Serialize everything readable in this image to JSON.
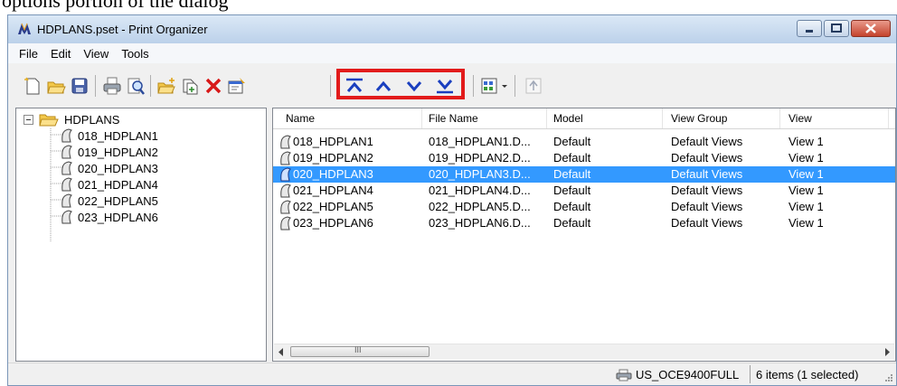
{
  "caption": "options portion of the dialog",
  "window": {
    "title": "HDPLANS.pset - Print Organizer",
    "app_icon": "microstation-icon"
  },
  "menu": [
    {
      "label": "File"
    },
    {
      "label": "Edit"
    },
    {
      "label": "View"
    },
    {
      "label": "Tools"
    }
  ],
  "toolbar_icons": [
    "new-icon",
    "open-folder-icon",
    "save-icon",
    "print-icon",
    "print-preview-icon",
    "add-folder-icon",
    "add-file-icon",
    "delete-icon",
    "properties-icon",
    "move-top-icon",
    "move-up-icon",
    "move-down-icon",
    "move-bottom-icon",
    "view-mode-icon",
    "up-level-icon"
  ],
  "colors": {
    "highlight": "#e21b1b",
    "selection": "#3399ff",
    "arrow_blue": "#1a3fbf"
  },
  "tree": {
    "root": "HDPLANS",
    "items": [
      "018_HDPLAN1",
      "019_HDPLAN2",
      "020_HDPLAN3",
      "021_HDPLAN4",
      "022_HDPLAN5",
      "023_HDPLAN6"
    ]
  },
  "list": {
    "columns": [
      "Name",
      "File Name",
      "Model",
      "View Group",
      "View"
    ],
    "rows": [
      {
        "name": "018_HDPLAN1",
        "file": "018_HDPLAN1.D...",
        "model": "Default",
        "group": "Default Views",
        "view": "View 1",
        "selected": false
      },
      {
        "name": "019_HDPLAN2",
        "file": "019_HDPLAN2.D...",
        "model": "Default",
        "group": "Default Views",
        "view": "View 1",
        "selected": false
      },
      {
        "name": "020_HDPLAN3",
        "file": "020_HDPLAN3.D...",
        "model": "Default",
        "group": "Default Views",
        "view": "View 1",
        "selected": true
      },
      {
        "name": "021_HDPLAN4",
        "file": "021_HDPLAN4.D...",
        "model": "Default",
        "group": "Default Views",
        "view": "View 1",
        "selected": false
      },
      {
        "name": "022_HDPLAN5",
        "file": "022_HDPLAN5.D...",
        "model": "Default",
        "group": "Default Views",
        "view": "View 1",
        "selected": false
      },
      {
        "name": "023_HDPLAN6",
        "file": "023_HDPLAN6.D...",
        "model": "Default",
        "group": "Default Views",
        "view": "View 1",
        "selected": false
      }
    ],
    "scroll_thumb_mark": "III"
  },
  "status": {
    "printer": "US_OCE9400FULL",
    "count": "6 items (1 selected)"
  }
}
